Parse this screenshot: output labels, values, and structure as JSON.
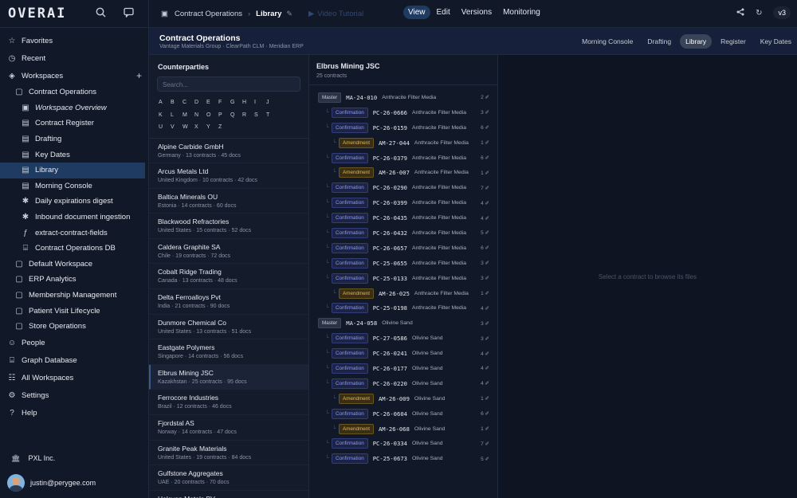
{
  "app": {
    "logo": "OVERAI"
  },
  "sidebar": {
    "top_items": [
      {
        "label": "Favorites",
        "icon": "star-icon"
      },
      {
        "label": "Recent",
        "icon": "clock-icon"
      },
      {
        "label": "Workspaces",
        "icon": "layers-icon"
      }
    ],
    "workspace_tree": [
      {
        "label": "Contract Operations",
        "level": 1
      },
      {
        "label": "Workspace Overview",
        "level": 2
      },
      {
        "label": "Contract Register",
        "level": 2
      },
      {
        "label": "Drafting",
        "level": 2
      },
      {
        "label": "Key Dates",
        "level": 2
      },
      {
        "label": "Library",
        "level": 2
      },
      {
        "label": "Morning Console",
        "level": 2
      },
      {
        "label": "Daily expirations digest",
        "level": 2
      },
      {
        "label": "Inbound document ingestion",
        "level": 2
      },
      {
        "label": "extract-contract-fields",
        "level": 2
      },
      {
        "label": "Contract Operations DB",
        "level": 2
      },
      {
        "label": "Default Workspace",
        "level": 1
      },
      {
        "label": "ERP Analytics",
        "level": 1
      },
      {
        "label": "Membership Management",
        "level": 1
      },
      {
        "label": "Patient Visit Lifecycle",
        "level": 1
      },
      {
        "label": "Store Operations",
        "level": 1
      }
    ],
    "bottom_items": [
      {
        "label": "People",
        "icon": "people-icon"
      },
      {
        "label": "Graph Database",
        "icon": "database-icon"
      },
      {
        "label": "All Workspaces",
        "icon": "grid-icon"
      },
      {
        "label": "Settings",
        "icon": "gear-icon"
      },
      {
        "label": "Help",
        "icon": "help-icon"
      }
    ],
    "org": "PXL Inc.",
    "user_email": "justin@perygee.com"
  },
  "topbar": {
    "crumb_parent": "Contract Operations",
    "crumb_current": "Library",
    "video_tutorial": "Video Tutorial",
    "modes": [
      "View",
      "Edit",
      "Versions",
      "Monitoring"
    ],
    "active_mode": "View",
    "version": "v3"
  },
  "header": {
    "title": "Contract Operations",
    "subtitle": "Vantage Materials Group · ClearPath CLM · Meridian ERP",
    "tabs": [
      "Morning Console",
      "Drafting",
      "Library",
      "Register",
      "Key Dates"
    ],
    "active_tab": "Library"
  },
  "counterparties": {
    "title": "Counterparties",
    "search_placeholder": "Search...",
    "letters": [
      "A",
      "B",
      "C",
      "D",
      "E",
      "F",
      "G",
      "H",
      "I",
      "J",
      "K",
      "L",
      "M",
      "N",
      "O",
      "P",
      "Q",
      "R",
      "S",
      "T",
      "U",
      "V",
      "W",
      "X",
      "Y",
      "Z"
    ],
    "items": [
      {
        "name": "Alpine Carbide GmbH",
        "meta": "Germany · 13 contracts · 45 docs"
      },
      {
        "name": "Arcus Metals Ltd",
        "meta": "United Kingdom · 10 contracts · 42 docs"
      },
      {
        "name": "Baltica Minerals OU",
        "meta": "Estonia · 14 contracts · 60 docs"
      },
      {
        "name": "Blackwood Refractories",
        "meta": "United States · 15 contracts · 52 docs"
      },
      {
        "name": "Caldera Graphite SA",
        "meta": "Chile · 19 contracts · 72 docs"
      },
      {
        "name": "Cobalt Ridge Trading",
        "meta": "Canada · 13 contracts · 48 docs"
      },
      {
        "name": "Delta Ferroalloys Pvt",
        "meta": "India · 21 contracts · 90 docs"
      },
      {
        "name": "Dunmore Chemical Co",
        "meta": "United States · 13 contracts · 51 docs"
      },
      {
        "name": "Eastgate Polymers",
        "meta": "Singapore · 14 contracts · 56 docs"
      },
      {
        "name": "Elbrus Mining JSC",
        "meta": "Kazakhstan · 25 contracts · 95 docs",
        "selected": true
      },
      {
        "name": "Ferrocore Industries",
        "meta": "Brazil · 12 contracts · 46 docs"
      },
      {
        "name": "Fjordstal AS",
        "meta": "Norway · 14 contracts · 47 docs"
      },
      {
        "name": "Granite Peak Materials",
        "meta": "United States · 19 contracts · 84 docs"
      },
      {
        "name": "Gulfstone Aggregates",
        "meta": "UAE · 20 contracts · 70 docs"
      },
      {
        "name": "Halcyon Metals BV",
        "meta": ""
      }
    ]
  },
  "contracts": {
    "title": "Elbrus Mining JSC",
    "count": "25 contracts",
    "rows": [
      {
        "type": "Master",
        "code": "MA-24-010",
        "desc": "Anthracite Filter Media",
        "docs": "2",
        "indent": 0
      },
      {
        "type": "Confirmation",
        "code": "PC-26-0666",
        "desc": "Anthracite Filter Media",
        "docs": "3",
        "indent": 1
      },
      {
        "type": "Confirmation",
        "code": "PC-26-0159",
        "desc": "Anthracite Filter Media",
        "docs": "6",
        "indent": 1
      },
      {
        "type": "Amendment",
        "code": "AM-27-044",
        "desc": "Anthracite Filter Media",
        "docs": "1",
        "indent": 2
      },
      {
        "type": "Confirmation",
        "code": "PC-26-0379",
        "desc": "Anthracite Filter Media",
        "docs": "6",
        "indent": 1
      },
      {
        "type": "Amendment",
        "code": "AM-26-007",
        "desc": "Anthracite Filter Media",
        "docs": "1",
        "indent": 2
      },
      {
        "type": "Confirmation",
        "code": "PC-26-0290",
        "desc": "Anthracite Filter Media",
        "docs": "7",
        "indent": 1
      },
      {
        "type": "Confirmation",
        "code": "PC-26-0399",
        "desc": "Anthracite Filter Media",
        "docs": "4",
        "indent": 1
      },
      {
        "type": "Confirmation",
        "code": "PC-26-0435",
        "desc": "Anthracite Filter Media",
        "docs": "4",
        "indent": 1
      },
      {
        "type": "Confirmation",
        "code": "PC-26-0432",
        "desc": "Anthracite Filter Media",
        "docs": "5",
        "indent": 1
      },
      {
        "type": "Confirmation",
        "code": "PC-26-0657",
        "desc": "Anthracite Filter Media",
        "docs": "6",
        "indent": 1
      },
      {
        "type": "Confirmation",
        "code": "PC-25-0655",
        "desc": "Anthracite Filter Media",
        "docs": "3",
        "indent": 1
      },
      {
        "type": "Confirmation",
        "code": "PC-25-0133",
        "desc": "Anthracite Filter Media",
        "docs": "3",
        "indent": 1
      },
      {
        "type": "Amendment",
        "code": "AM-26-025",
        "desc": "Anthracite Filter Media",
        "docs": "1",
        "indent": 2
      },
      {
        "type": "Confirmation",
        "code": "PC-25-0198",
        "desc": "Anthracite Filter Media",
        "docs": "4",
        "indent": 1
      },
      {
        "type": "Master",
        "code": "MA-24-058",
        "desc": "Olivine Sand",
        "docs": "3",
        "indent": 0
      },
      {
        "type": "Confirmation",
        "code": "PC-27-0586",
        "desc": "Olivine Sand",
        "docs": "3",
        "indent": 1
      },
      {
        "type": "Confirmation",
        "code": "PC-26-0241",
        "desc": "Olivine Sand",
        "docs": "4",
        "indent": 1
      },
      {
        "type": "Confirmation",
        "code": "PC-26-0177",
        "desc": "Olivine Sand",
        "docs": "4",
        "indent": 1
      },
      {
        "type": "Confirmation",
        "code": "PC-26-0220",
        "desc": "Olivine Sand",
        "docs": "4",
        "indent": 1
      },
      {
        "type": "Amendment",
        "code": "AM-26-009",
        "desc": "Olivine Sand",
        "docs": "1",
        "indent": 2
      },
      {
        "type": "Confirmation",
        "code": "PC-26-0604",
        "desc": "Olivine Sand",
        "docs": "6",
        "indent": 1
      },
      {
        "type": "Amendment",
        "code": "AM-26-068",
        "desc": "Olivine Sand",
        "docs": "1",
        "indent": 2
      },
      {
        "type": "Confirmation",
        "code": "PC-26-0334",
        "desc": "Olivine Sand",
        "docs": "7",
        "indent": 1
      },
      {
        "type": "Confirmation",
        "code": "PC-25-0673",
        "desc": "Olivine Sand",
        "docs": "5",
        "indent": 1
      }
    ]
  },
  "preview": {
    "empty_text": "Select a contract to browse its files"
  }
}
